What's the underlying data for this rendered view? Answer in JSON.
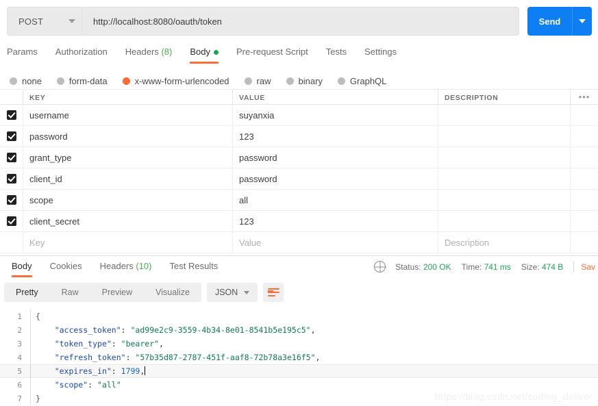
{
  "request": {
    "method": "POST",
    "url": "http://localhost:8080/oauth/token",
    "send_label": "Send",
    "tabs": [
      {
        "label": "Params",
        "active": false
      },
      {
        "label": "Authorization",
        "active": false
      },
      {
        "label": "Headers",
        "count": "(8)",
        "active": false
      },
      {
        "label": "Body",
        "active": true,
        "dot": true
      },
      {
        "label": "Pre-request Script",
        "active": false
      },
      {
        "label": "Tests",
        "active": false
      },
      {
        "label": "Settings",
        "active": false
      }
    ],
    "body_types": [
      {
        "label": "none",
        "selected": false
      },
      {
        "label": "form-data",
        "selected": false
      },
      {
        "label": "x-www-form-urlencoded",
        "selected": true
      },
      {
        "label": "raw",
        "selected": false
      },
      {
        "label": "binary",
        "selected": false
      },
      {
        "label": "GraphQL",
        "selected": false
      }
    ]
  },
  "table": {
    "headers": {
      "key": "KEY",
      "value": "VALUE",
      "description": "DESCRIPTION"
    },
    "placeholders": {
      "key": "Key",
      "value": "Value",
      "description": "Description"
    },
    "rows": [
      {
        "checked": true,
        "key": "username",
        "value": "suyanxia",
        "description": ""
      },
      {
        "checked": true,
        "key": "password",
        "value": "123",
        "description": ""
      },
      {
        "checked": true,
        "key": "grant_type",
        "value": "password",
        "description": ""
      },
      {
        "checked": true,
        "key": "client_id",
        "value": "password",
        "description": ""
      },
      {
        "checked": true,
        "key": "scope",
        "value": "all",
        "description": ""
      },
      {
        "checked": true,
        "key": "client_secret",
        "value": "123",
        "description": ""
      }
    ]
  },
  "response": {
    "tabs": [
      {
        "label": "Body",
        "active": true
      },
      {
        "label": "Cookies",
        "active": false
      },
      {
        "label": "Headers",
        "count": "(10)",
        "active": false
      },
      {
        "label": "Test Results",
        "active": false
      }
    ],
    "status": {
      "status_label": "Status:",
      "status_value": "200 OK",
      "time_label": "Time:",
      "time_value": "741 ms",
      "size_label": "Size:",
      "size_value": "474 B",
      "save_label": "Sav"
    },
    "toolbar": {
      "views": [
        {
          "label": "Pretty",
          "active": true
        },
        {
          "label": "Raw",
          "active": false
        },
        {
          "label": "Preview",
          "active": false
        },
        {
          "label": "Visualize",
          "active": false
        }
      ],
      "format": "JSON"
    },
    "body_lines": [
      {
        "num": "1",
        "active": false,
        "tokens": [
          {
            "t": "brace",
            "v": "{"
          }
        ]
      },
      {
        "num": "2",
        "active": false,
        "tokens": [
          {
            "t": "plain",
            "v": "    "
          },
          {
            "t": "key",
            "v": "\"access_token\""
          },
          {
            "t": "punc",
            "v": ": "
          },
          {
            "t": "str",
            "v": "\"ad99e2c9-3559-4b34-8e01-8541b5e195c5\""
          },
          {
            "t": "punc",
            "v": ","
          }
        ]
      },
      {
        "num": "3",
        "active": false,
        "tokens": [
          {
            "t": "plain",
            "v": "    "
          },
          {
            "t": "key",
            "v": "\"token_type\""
          },
          {
            "t": "punc",
            "v": ": "
          },
          {
            "t": "str",
            "v": "\"bearer\""
          },
          {
            "t": "punc",
            "v": ","
          }
        ]
      },
      {
        "num": "4",
        "active": false,
        "tokens": [
          {
            "t": "plain",
            "v": "    "
          },
          {
            "t": "key",
            "v": "\"refresh_token\""
          },
          {
            "t": "punc",
            "v": ": "
          },
          {
            "t": "str",
            "v": "\"57b35d87-2787-451f-aaf8-72b78a3e16f5\""
          },
          {
            "t": "punc",
            "v": ","
          }
        ]
      },
      {
        "num": "5",
        "active": true,
        "caret": true,
        "tokens": [
          {
            "t": "plain",
            "v": "    "
          },
          {
            "t": "key",
            "v": "\"expires_in\""
          },
          {
            "t": "punc",
            "v": ": "
          },
          {
            "t": "num",
            "v": "1799"
          },
          {
            "t": "punc",
            "v": ","
          }
        ]
      },
      {
        "num": "6",
        "active": false,
        "tokens": [
          {
            "t": "plain",
            "v": "    "
          },
          {
            "t": "key",
            "v": "\"scope\""
          },
          {
            "t": "punc",
            "v": ": "
          },
          {
            "t": "str",
            "v": "\"all\""
          }
        ]
      },
      {
        "num": "7",
        "active": false,
        "tokens": [
          {
            "t": "brace",
            "v": "}"
          }
        ]
      }
    ]
  },
  "watermark": "https://blog.csdn.net/coding_deliver",
  "colors": {
    "accent": "#ff6c37",
    "send": "#0d7ff2",
    "success": "#22a25a"
  }
}
